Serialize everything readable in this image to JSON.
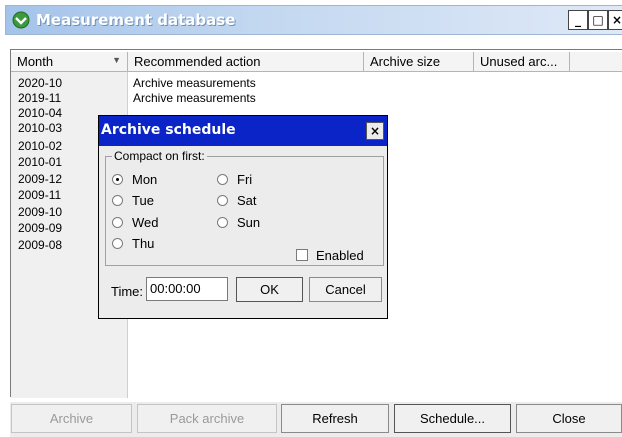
{
  "window": {
    "title": "Measurement database",
    "min_glyph": "_",
    "max_glyph": "□",
    "close_glyph": "×"
  },
  "table": {
    "columns": [
      "Month",
      "Recommended action",
      "Archive size",
      "Unused arc..."
    ],
    "rows": [
      {
        "month": "2020-10",
        "action": "Archive measurements"
      },
      {
        "month": "2019-11",
        "action": "Archive measurements"
      },
      {
        "month": "2010-04",
        "action": ""
      },
      {
        "month": "2010-03",
        "action": ""
      },
      {
        "month": "2010-02",
        "action": ""
      },
      {
        "month": "2010-01",
        "action": ""
      },
      {
        "month": "2009-12",
        "action": ""
      },
      {
        "month": "2009-11",
        "action": ""
      },
      {
        "month": "2009-10",
        "action": ""
      },
      {
        "month": "2009-09",
        "action": ""
      },
      {
        "month": "2009-08",
        "action": ""
      }
    ]
  },
  "buttons": {
    "archive": "Archive",
    "pack_archive": "Pack archive",
    "refresh": "Refresh",
    "schedule": "Schedule...",
    "close": "Close"
  },
  "dialog": {
    "title": "Archive schedule",
    "close_glyph": "×",
    "group_label": "Compact on first:",
    "days": [
      {
        "label": "Mon",
        "checked": true
      },
      {
        "label": "Tue",
        "checked": false
      },
      {
        "label": "Wed",
        "checked": false
      },
      {
        "label": "Thu",
        "checked": false
      },
      {
        "label": "Fri",
        "checked": false
      },
      {
        "label": "Sat",
        "checked": false
      },
      {
        "label": "Sun",
        "checked": false
      }
    ],
    "enabled_label": "Enabled",
    "enabled_checked": false,
    "time_label": "Time:",
    "time_value": "00:00:00",
    "ok": "OK",
    "cancel": "Cancel"
  }
}
